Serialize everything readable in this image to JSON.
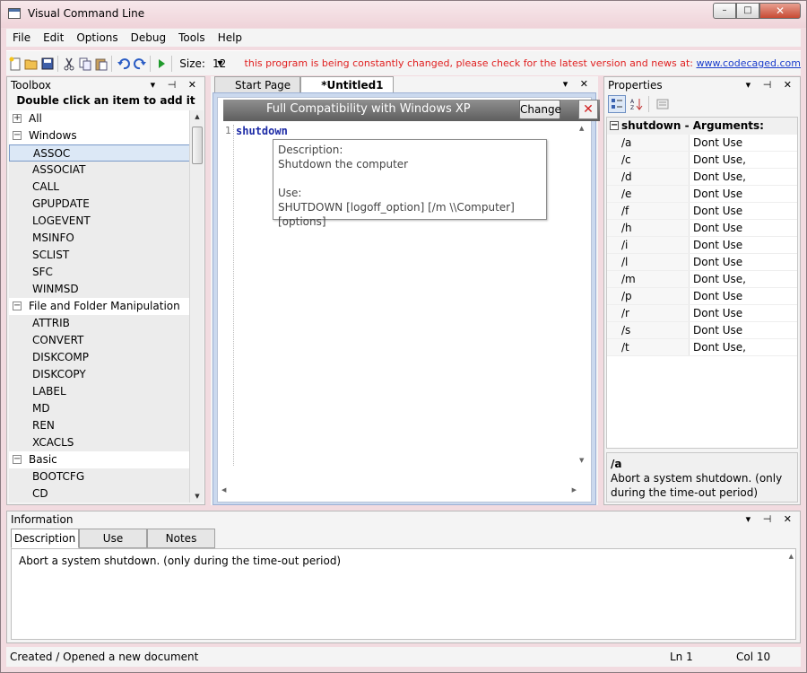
{
  "window": {
    "title": "Visual Command Line",
    "controls": [
      "–",
      "□",
      "✕"
    ]
  },
  "menu": [
    "File",
    "Edit",
    "Options",
    "Debug",
    "Tools",
    "Help"
  ],
  "toolbar": {
    "size_label": "Size:",
    "size_value": "12",
    "news_text": "this program is being constantly changed, please check for the latest version and news at:",
    "news_link": "www.codecaged.com",
    "icons": [
      "new-file-icon",
      "open-folder-icon",
      "save-icon",
      "cut-icon",
      "copy-icon",
      "paste-icon",
      "undo-icon",
      "redo-icon",
      "run-icon"
    ]
  },
  "toolbox": {
    "title": "Toolbox",
    "hint": "Double click an item to add it",
    "groups": [
      {
        "name": "All",
        "expanded": false,
        "items": []
      },
      {
        "name": "Windows",
        "expanded": true,
        "items": [
          "ASSOC",
          "ASSOCIAT",
          "CALL",
          "GPUPDATE",
          "LOGEVENT",
          "MSINFO",
          "SCLIST",
          "SFC",
          "WINMSD"
        ]
      },
      {
        "name": "File and Folder Manipulation",
        "expanded": true,
        "items": [
          "ATTRIB",
          "CONVERT",
          "DISKCOMP",
          "DISKCOPY",
          "LABEL",
          "MD",
          "REN",
          "XCACLS"
        ]
      },
      {
        "name": "Basic",
        "expanded": true,
        "items": [
          "BOOTCFG",
          "CD"
        ]
      }
    ],
    "selected": "ASSOC"
  },
  "editor": {
    "tabs": [
      {
        "label": "Start Page",
        "active": false
      },
      {
        "label": "*Untitled1",
        "active": true
      }
    ],
    "compat_text": "Full Compatibility with Windows XP",
    "change_label": "Change",
    "close_label": "✕",
    "line_number": "1",
    "code": "shutdown",
    "tooltip": {
      "desc_label": "Description:",
      "desc": "Shutdown the computer",
      "use_label": "Use:",
      "use": "SHUTDOWN [logoff_option]  [/m \\\\Computer] [options]"
    }
  },
  "properties": {
    "title": "Properties",
    "category": "shutdown - Arguments:",
    "rows": [
      {
        "name": "/a",
        "value": "Dont Use"
      },
      {
        "name": "/c",
        "value": "Dont Use,"
      },
      {
        "name": "/d",
        "value": "Dont Use,"
      },
      {
        "name": "/e",
        "value": "Dont Use"
      },
      {
        "name": "/f",
        "value": "Dont Use"
      },
      {
        "name": "/h",
        "value": "Dont Use"
      },
      {
        "name": "/i",
        "value": "Dont Use"
      },
      {
        "name": "/l",
        "value": "Dont Use"
      },
      {
        "name": "/m",
        "value": "Dont Use,"
      },
      {
        "name": "/p",
        "value": "Dont Use"
      },
      {
        "name": "/r",
        "value": "Dont Use"
      },
      {
        "name": "/s",
        "value": "Dont Use"
      },
      {
        "name": "/t",
        "value": "Dont Use,"
      }
    ],
    "desc_name": "/a",
    "desc_text": "Abort a system shutdown. (only during the time-out period)"
  },
  "information": {
    "title": "Information",
    "tabs": [
      "Description",
      "Use",
      "Notes"
    ],
    "active_tab": "Description",
    "body": "Abort a system shutdown. (only during the time-out period)"
  },
  "status": {
    "message": "Created / Opened a new document",
    "line": "Ln 1",
    "col": "Col 10"
  },
  "panel_buttons": "▾ ⊣ ✕"
}
